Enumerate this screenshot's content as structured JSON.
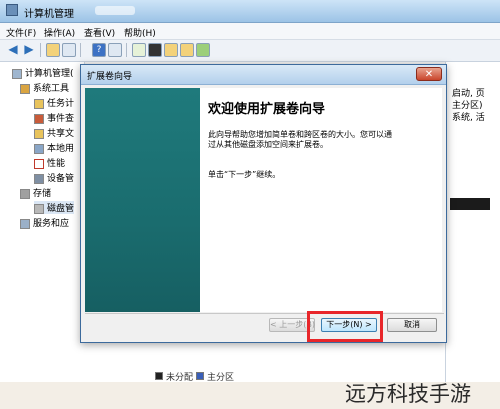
{
  "window": {
    "title": "计算机管理"
  },
  "menu": [
    "文件(F)",
    "操作(A)",
    "查看(V)",
    "帮助(H)"
  ],
  "tree": [
    {
      "label": "计算机管理(",
      "indent": 0
    },
    {
      "label": "系统工具",
      "indent": 1
    },
    {
      "label": "任务计",
      "indent": 2
    },
    {
      "label": "事件查",
      "indent": 2
    },
    {
      "label": "共享文",
      "indent": 2
    },
    {
      "label": "本地用",
      "indent": 2
    },
    {
      "label": "性能",
      "indent": 2
    },
    {
      "label": "设备管",
      "indent": 2
    },
    {
      "label": "存储",
      "indent": 1
    },
    {
      "label": "磁盘管",
      "indent": 2
    },
    {
      "label": "服务和应",
      "indent": 1
    }
  ],
  "right_panel": [
    "启动, 页",
    "主分区)",
    "系统, 活"
  ],
  "legend": [
    "未分配",
    "主分区"
  ],
  "dialog": {
    "title": "扩展卷向导",
    "close": "✕",
    "heading": "欢迎使用扩展卷向导",
    "para1_line1": "此向导帮助您增加简单卷和跨区卷的大小。您可以通",
    "para1_line2": "过从其他磁盘添加空间来扩展卷。",
    "para2": "单击“下一步”继续。",
    "btn_back": "< 上一步(B)",
    "btn_next": "下一步(N) >",
    "btn_cancel": "取消"
  },
  "watermark": "远方科技手游"
}
